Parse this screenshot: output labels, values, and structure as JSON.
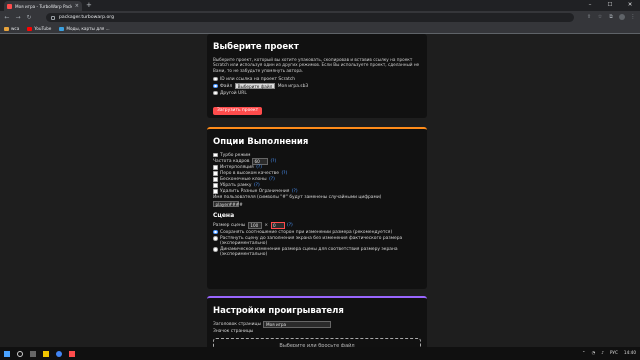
{
  "browser": {
    "tab_title": "Моя игра - TurboWarp Packager",
    "url": "packager.turbowarp.org",
    "bookmarks": [
      "wca",
      "YouTube",
      "Моды, карты для ..."
    ]
  },
  "project_section": {
    "title": "Выберите проект",
    "description": "Выберите проект, который вы хотите упаковать, скопировав и вставив ссылку на проект Scratch или используя один из других режимов. Если Вы используете проект, сделанный не Вами, то не забудьте упомянуть автора.",
    "options": [
      "ID или ссылка на проект Scratch",
      "Файл",
      "Другой URL"
    ],
    "file_button": "Выберите файл",
    "file_name": "Моя игра.sb3",
    "load_button": "Загрузить проект"
  },
  "runtime_section": {
    "title": "Опции Выполнения",
    "help": "(?)",
    "options": [
      {
        "label": "Турбо режим",
        "help": false
      },
      {
        "label": "Интерполяция",
        "help": true
      },
      {
        "label": "Перо в высоком качестве",
        "help": true
      },
      {
        "label": "Бесконечные клоны",
        "help": true
      },
      {
        "label": "Убрать рамку",
        "help": true
      },
      {
        "label": "Удалить Разные Ограничения",
        "help": true
      }
    ],
    "framerate_label": "Частота кадров",
    "framerate_value": "60",
    "username_label": "Имя пользователя (символы \"#\" будут заменены случайными цифрами)",
    "username_value": "player####"
  },
  "stage_section": {
    "title": "Сцена",
    "size_label": "Размер сцены",
    "width": "100",
    "height": "0",
    "times": "×",
    "options": [
      "Сохранять соотношение сторон при изменении размера (рекомендуется)",
      "Растянуть сцену до заполнения экрана без изменения фактического размера (экспериментально)",
      "Динамическое изменение размера сцены для соответствия размеру экрана (экспериментально)"
    ]
  },
  "player_section": {
    "title": "Настройки проигрывателя",
    "page_title_label": "Заголовок страницы",
    "page_title_value": "Моя игра",
    "icon_label": "Значок страницы",
    "drop_text": "Выберите или бросьте файл"
  },
  "taskbar": {
    "lang": "РУС",
    "time": "14:40"
  },
  "colors": {
    "accent_runtime": "#ff8c1a",
    "accent_player": "#9966ff",
    "danger": "#ff4c4c",
    "link": "#4c97ff"
  }
}
